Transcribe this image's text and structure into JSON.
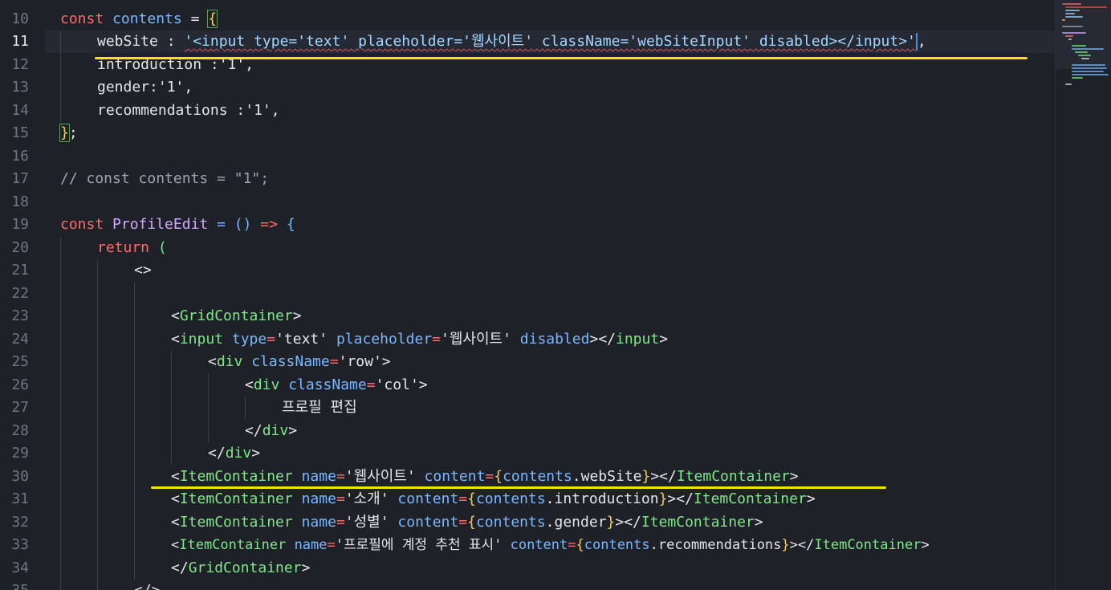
{
  "editor": {
    "language": "javascript-jsx",
    "active_line": "11",
    "line_numbers": [
      "10",
      "11",
      "12",
      "13",
      "14",
      "15",
      "16",
      "17",
      "18",
      "19",
      "20",
      "21",
      "22",
      "23",
      "24",
      "25",
      "26",
      "27",
      "28",
      "29",
      "30",
      "31",
      "32",
      "33",
      "34",
      "35"
    ],
    "colors": {
      "background": "#1e2128",
      "annotation_underline": "#f5e400",
      "error_squiggle": "#e05252",
      "caret": "#4a90e2"
    }
  },
  "code": {
    "l10": {
      "const": "const",
      "name": "contents",
      "eq": " = ",
      "open": "{"
    },
    "l11": {
      "key": "webSite",
      "colon": " : ",
      "value": "'<input type='text' placeholder='웹사이트' className='webSiteInput' disabled></input>'",
      "comma": ","
    },
    "l12": {
      "text": "introduction :'1',"
    },
    "l13": {
      "text": "gender:'1',"
    },
    "l14": {
      "key": "recommendations",
      "rest": " :'1',"
    },
    "l15": {
      "close": "}",
      "semi": ";"
    },
    "l17": {
      "comment": "// const contents = \"1\";"
    },
    "l19": {
      "const": "const",
      "name": "ProfileEdit",
      "eq": " = ",
      "args": "()",
      "arrow": " => ",
      "open": "{"
    },
    "l20": {
      "return": "return",
      "paren": " ("
    },
    "l21": {
      "frag": "<>"
    },
    "l23": {
      "lt": "<",
      "tag": "GridContainer",
      "gt": ">"
    },
    "l24": {
      "lt": "<",
      "tag": "input",
      "a1": "type",
      "v1": "'text'",
      "a2": "placeholder",
      "v2": "'웹사이트'",
      "a3": "disabled",
      "close_open": "></",
      "tag2": "input",
      "gt": ">"
    },
    "l25": {
      "lt": "<",
      "tag": "div",
      "a1": "className",
      "v1": "'row'",
      "gt": ">"
    },
    "l26": {
      "lt": "<",
      "tag": "div",
      "a1": "className",
      "v1": "'col'",
      "gt": ">"
    },
    "l27": {
      "text": "프로필 편집"
    },
    "l28": {
      "lt": "</",
      "tag": "div",
      "gt": ">"
    },
    "l29": {
      "lt": "</",
      "tag": "div",
      "gt": ">"
    },
    "l30": {
      "lt": "<",
      "tag": "ItemContainer",
      "a1": "name",
      "v1": "'웹사이트'",
      "a2": "content",
      "expr_obj": "contents",
      "expr_prop": ".webSite",
      "close": "></",
      "tag2": "ItemContainer",
      "gt": ">"
    },
    "l31": {
      "lt": "<",
      "tag": "ItemContainer",
      "a1": "name",
      "v1": "'소개'",
      "a2": "content",
      "expr_obj": "contents",
      "expr_prop": ".introduction",
      "close": "></",
      "tag2": "ItemContainer",
      "gt": ">"
    },
    "l32": {
      "lt": "<",
      "tag": "ItemContainer",
      "a1": "name",
      "v1": "'성별'",
      "a2": "content",
      "expr_obj": "contents",
      "expr_prop": ".gender",
      "close": "></",
      "tag2": "ItemContainer",
      "gt": ">"
    },
    "l33": {
      "lt": "<",
      "tag": "ItemContainer",
      "a1": "name",
      "v1": "'프로필에 계정 추천 표시'",
      "a2": "content",
      "expr_obj": "contents",
      "expr_prop": ".recommendations",
      "close": "></",
      "tag2": "ItemContainer",
      "gt": ">"
    },
    "l34": {
      "lt": "</",
      "tag": "GridContainer",
      "gt": ">"
    },
    "l35": {
      "text": "</>"
    }
  }
}
